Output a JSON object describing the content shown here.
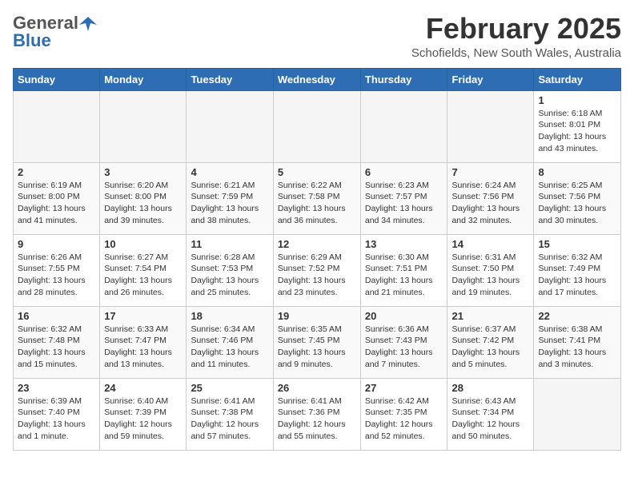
{
  "header": {
    "logo_general": "General",
    "logo_blue": "Blue",
    "month_year": "February 2025",
    "location": "Schofields, New South Wales, Australia"
  },
  "weekdays": [
    "Sunday",
    "Monday",
    "Tuesday",
    "Wednesday",
    "Thursday",
    "Friday",
    "Saturday"
  ],
  "weeks": [
    [
      {
        "day": "",
        "info": ""
      },
      {
        "day": "",
        "info": ""
      },
      {
        "day": "",
        "info": ""
      },
      {
        "day": "",
        "info": ""
      },
      {
        "day": "",
        "info": ""
      },
      {
        "day": "",
        "info": ""
      },
      {
        "day": "1",
        "info": "Sunrise: 6:18 AM\nSunset: 8:01 PM\nDaylight: 13 hours\nand 43 minutes."
      }
    ],
    [
      {
        "day": "2",
        "info": "Sunrise: 6:19 AM\nSunset: 8:00 PM\nDaylight: 13 hours\nand 41 minutes."
      },
      {
        "day": "3",
        "info": "Sunrise: 6:20 AM\nSunset: 8:00 PM\nDaylight: 13 hours\nand 39 minutes."
      },
      {
        "day": "4",
        "info": "Sunrise: 6:21 AM\nSunset: 7:59 PM\nDaylight: 13 hours\nand 38 minutes."
      },
      {
        "day": "5",
        "info": "Sunrise: 6:22 AM\nSunset: 7:58 PM\nDaylight: 13 hours\nand 36 minutes."
      },
      {
        "day": "6",
        "info": "Sunrise: 6:23 AM\nSunset: 7:57 PM\nDaylight: 13 hours\nand 34 minutes."
      },
      {
        "day": "7",
        "info": "Sunrise: 6:24 AM\nSunset: 7:56 PM\nDaylight: 13 hours\nand 32 minutes."
      },
      {
        "day": "8",
        "info": "Sunrise: 6:25 AM\nSunset: 7:56 PM\nDaylight: 13 hours\nand 30 minutes."
      }
    ],
    [
      {
        "day": "9",
        "info": "Sunrise: 6:26 AM\nSunset: 7:55 PM\nDaylight: 13 hours\nand 28 minutes."
      },
      {
        "day": "10",
        "info": "Sunrise: 6:27 AM\nSunset: 7:54 PM\nDaylight: 13 hours\nand 26 minutes."
      },
      {
        "day": "11",
        "info": "Sunrise: 6:28 AM\nSunset: 7:53 PM\nDaylight: 13 hours\nand 25 minutes."
      },
      {
        "day": "12",
        "info": "Sunrise: 6:29 AM\nSunset: 7:52 PM\nDaylight: 13 hours\nand 23 minutes."
      },
      {
        "day": "13",
        "info": "Sunrise: 6:30 AM\nSunset: 7:51 PM\nDaylight: 13 hours\nand 21 minutes."
      },
      {
        "day": "14",
        "info": "Sunrise: 6:31 AM\nSunset: 7:50 PM\nDaylight: 13 hours\nand 19 minutes."
      },
      {
        "day": "15",
        "info": "Sunrise: 6:32 AM\nSunset: 7:49 PM\nDaylight: 13 hours\nand 17 minutes."
      }
    ],
    [
      {
        "day": "16",
        "info": "Sunrise: 6:32 AM\nSunset: 7:48 PM\nDaylight: 13 hours\nand 15 minutes."
      },
      {
        "day": "17",
        "info": "Sunrise: 6:33 AM\nSunset: 7:47 PM\nDaylight: 13 hours\nand 13 minutes."
      },
      {
        "day": "18",
        "info": "Sunrise: 6:34 AM\nSunset: 7:46 PM\nDaylight: 13 hours\nand 11 minutes."
      },
      {
        "day": "19",
        "info": "Sunrise: 6:35 AM\nSunset: 7:45 PM\nDaylight: 13 hours\nand 9 minutes."
      },
      {
        "day": "20",
        "info": "Sunrise: 6:36 AM\nSunset: 7:43 PM\nDaylight: 13 hours\nand 7 minutes."
      },
      {
        "day": "21",
        "info": "Sunrise: 6:37 AM\nSunset: 7:42 PM\nDaylight: 13 hours\nand 5 minutes."
      },
      {
        "day": "22",
        "info": "Sunrise: 6:38 AM\nSunset: 7:41 PM\nDaylight: 13 hours\nand 3 minutes."
      }
    ],
    [
      {
        "day": "23",
        "info": "Sunrise: 6:39 AM\nSunset: 7:40 PM\nDaylight: 13 hours\nand 1 minute."
      },
      {
        "day": "24",
        "info": "Sunrise: 6:40 AM\nSunset: 7:39 PM\nDaylight: 12 hours\nand 59 minutes."
      },
      {
        "day": "25",
        "info": "Sunrise: 6:41 AM\nSunset: 7:38 PM\nDaylight: 12 hours\nand 57 minutes."
      },
      {
        "day": "26",
        "info": "Sunrise: 6:41 AM\nSunset: 7:36 PM\nDaylight: 12 hours\nand 55 minutes."
      },
      {
        "day": "27",
        "info": "Sunrise: 6:42 AM\nSunset: 7:35 PM\nDaylight: 12 hours\nand 52 minutes."
      },
      {
        "day": "28",
        "info": "Sunrise: 6:43 AM\nSunset: 7:34 PM\nDaylight: 12 hours\nand 50 minutes."
      },
      {
        "day": "",
        "info": ""
      }
    ]
  ]
}
